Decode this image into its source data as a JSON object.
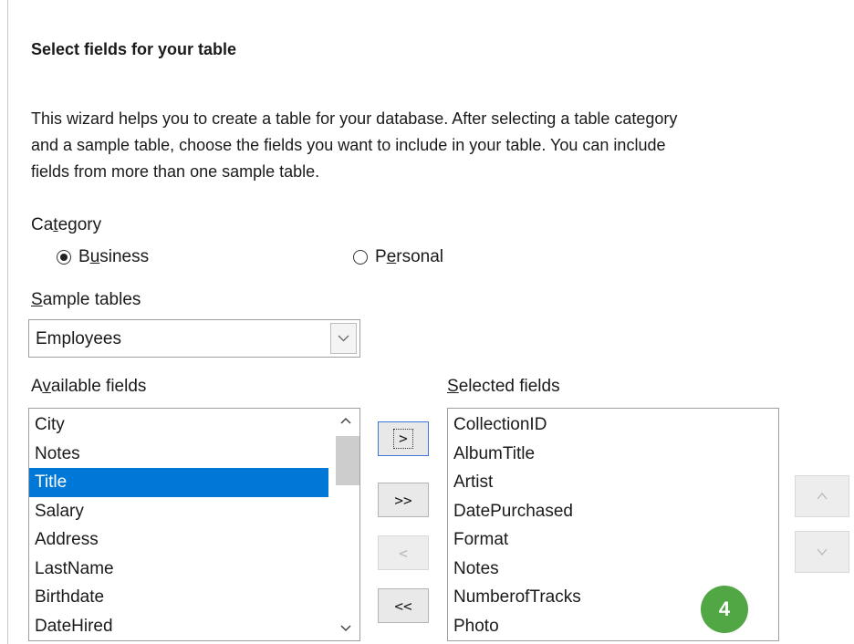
{
  "heading": "Select fields for your table",
  "description": [
    "This wizard helps you to create a table for your database. After selecting a table category",
    "and a sample table, choose the fields you want to include in your table. You can include",
    "fields from more than one sample table."
  ],
  "category": {
    "label_pre": "Ca",
    "label_key": "t",
    "label_post": "egory",
    "options": [
      {
        "pre": "B",
        "key": "u",
        "post": "siness",
        "selected": true
      },
      {
        "pre": "P",
        "key": "e",
        "post": "rsonal",
        "selected": false
      }
    ]
  },
  "sample_tables": {
    "label_key": "S",
    "label_post": "ample tables",
    "value": "Employees"
  },
  "available_fields": {
    "label_pre": "A",
    "label_key": "v",
    "label_post": "ailable fields",
    "items": [
      "City",
      "Notes",
      "Title",
      "Salary",
      "Address",
      "LastName",
      "Birthdate",
      "DateHired"
    ],
    "selected_index": 2
  },
  "selected_fields": {
    "label_key": "S",
    "label_post": "elected fields",
    "items": [
      "CollectionID",
      "AlbumTitle",
      "Artist",
      "DatePurchased",
      "Format",
      "Notes",
      "NumberofTracks",
      "Photo"
    ]
  },
  "move_buttons": {
    "add_one": ">",
    "add_all": ">>",
    "remove_one": "<",
    "remove_all": "<<"
  },
  "order_buttons": {
    "up": "^",
    "down": "v"
  },
  "callout": "4",
  "colors": {
    "selection": "#0078d7",
    "callout": "#52a745"
  }
}
